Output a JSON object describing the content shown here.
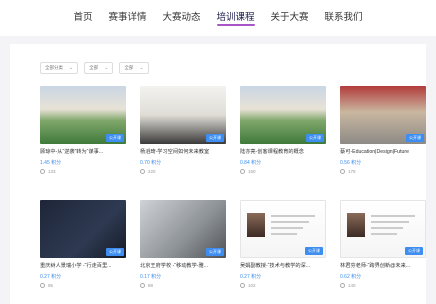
{
  "nav": {
    "items": [
      "首页",
      "赛事详情",
      "大赛动态",
      "培训课程",
      "关于大赛",
      "联系我们"
    ],
    "active_index": 3,
    "accent": "#a855c8"
  },
  "filters": [
    {
      "label": "全部分类"
    },
    {
      "label": "全部"
    },
    {
      "label": "全部"
    }
  ],
  "courses": [
    {
      "title": "顾琼中-从“逆袭”转为“谋事...",
      "price": "1.45 积分",
      "views": "133",
      "tag": "公开课",
      "thumb_icon": "classroom-photo"
    },
    {
      "title": "杨滔琦-学习空间如何未来教室",
      "price": "0.70 积分",
      "views": "220",
      "tag": "公开课",
      "thumb_icon": "lecture-photo"
    },
    {
      "title": "陆亦亮-创客课程教育的概念",
      "price": "0.84 积分",
      "views": "150",
      "tag": "公开课",
      "thumb_icon": "classroom-photo"
    },
    {
      "title": "蔡可-Education|Design|Future",
      "price": "0.56 积分",
      "views": "178",
      "tag": "公开课",
      "thumb_icon": "event-photo"
    },
    {
      "title": "重庆树人景瑞小学 -“行走百里...",
      "price": "0.27 积分",
      "views": "95",
      "tag": "公开课",
      "thumb_icon": "slides-photo"
    },
    {
      "title": "北京王府学校 -“移动教学-雅...",
      "price": "0.17 积分",
      "views": "88",
      "tag": "公开课",
      "thumb_icon": "tech-photo"
    },
    {
      "title": "吴娟副教授-“技术与教学的深...",
      "price": "0.27 积分",
      "views": "102",
      "tag": "公开课",
      "thumb_icon": "portrait-card"
    },
    {
      "title": "林君芬老师-“跨界创新@未来...",
      "price": "0.62 积分",
      "views": "140",
      "tag": "公开课",
      "thumb_icon": "portrait-card"
    }
  ]
}
